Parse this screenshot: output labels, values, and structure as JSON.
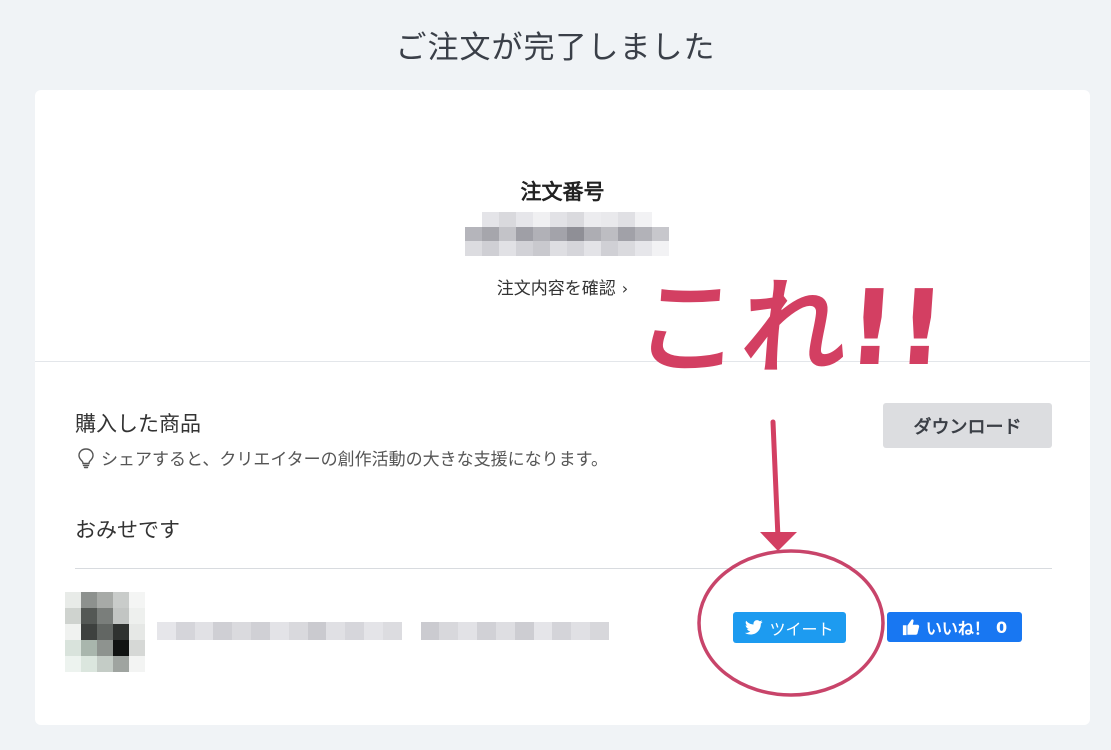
{
  "page": {
    "title": "ご注文が完了しました"
  },
  "order": {
    "label": "注文番号",
    "detail_link": "注文内容を確認",
    "chevron": "›",
    "number_blur_cells": [
      "#ffffff",
      "#e4e4e8",
      "#d9d9dd",
      "#e6e6ea",
      "#f0f0f2",
      "#e2e2e6",
      "#dadade",
      "#ececef",
      "#e9e9ec",
      "#e0e0e4",
      "#f2f2f4",
      "#ffffff",
      "#b5b5bb",
      "#a6a6ac",
      "#c3c3c8",
      "#9f9fa6",
      "#b1b1b7",
      "#a3a3aa",
      "#8f8f96",
      "#adadb3",
      "#bdbdc2",
      "#a1a1a8",
      "#b2b2b8",
      "#c7c7cc",
      "#dcdce0",
      "#cfcfd4",
      "#e1e1e5",
      "#d2d2d7",
      "#c9c9ce",
      "#dedee2",
      "#d5d5da",
      "#e3e3e7",
      "#d0d0d5",
      "#dadade",
      "#e6e6ea",
      "#f2f2f4"
    ]
  },
  "purchased": {
    "title": "購入した商品",
    "share_note": "シェアすると、クリエイターの創作活動の大きな支援になります。",
    "bulb_icon": "lightbulb-icon",
    "download_label": "ダウンロード"
  },
  "shop": {
    "name": "おみせです"
  },
  "product": {
    "thumb_cells": [
      "#e8ebe8",
      "#8d918e",
      "#a7aaa7",
      "#c9ccca",
      "#f4f5f4",
      "#cfd3cf",
      "#545855",
      "#7a7e7b",
      "#c2c5c3",
      "#eef0ee",
      "#f0f2f0",
      "#3e413f",
      "#626663",
      "#2f3230",
      "#e6e8e6",
      "#d9e3dc",
      "#a9b6ad",
      "#8e938f",
      "#111312",
      "#d6d8d6",
      "#edf3ef",
      "#dbe6de",
      "#c4ccc6",
      "#9fa4a0",
      "#f3f4f3"
    ],
    "title_blur_cells": [
      "#e6e6ea",
      "#d5d5da",
      "#e1e1e5",
      "#cfcfd4",
      "#dadade",
      "#d0d0d5",
      "#e3e3e7",
      "#d9d9dd",
      "#cacacf",
      "#e0e0e4",
      "#d6d6db",
      "#e4e4e8",
      "#dcdce0",
      "#ffffff",
      "#cbcbd0",
      "#d8d8dc",
      "#e2e2e6",
      "#d1d1d6",
      "#dedee2",
      "#cdcdd2",
      "#e5e5e9",
      "#d4d4d9",
      "#e0e0e4",
      "#d7d7db"
    ]
  },
  "share": {
    "tweet_label": "ツイート",
    "tweet_icon": "twitter-bird-icon",
    "like_label": "いいね！",
    "like_count": "0",
    "like_icon": "thumbs-up-icon"
  },
  "annotation": {
    "text": "これ!!",
    "color": "#d33f62"
  },
  "colors": {
    "background": "#f0f3f6",
    "card": "#ffffff",
    "twitter": "#1d9bf0",
    "facebook": "#1877f2",
    "download_bg": "#dcdde0"
  }
}
